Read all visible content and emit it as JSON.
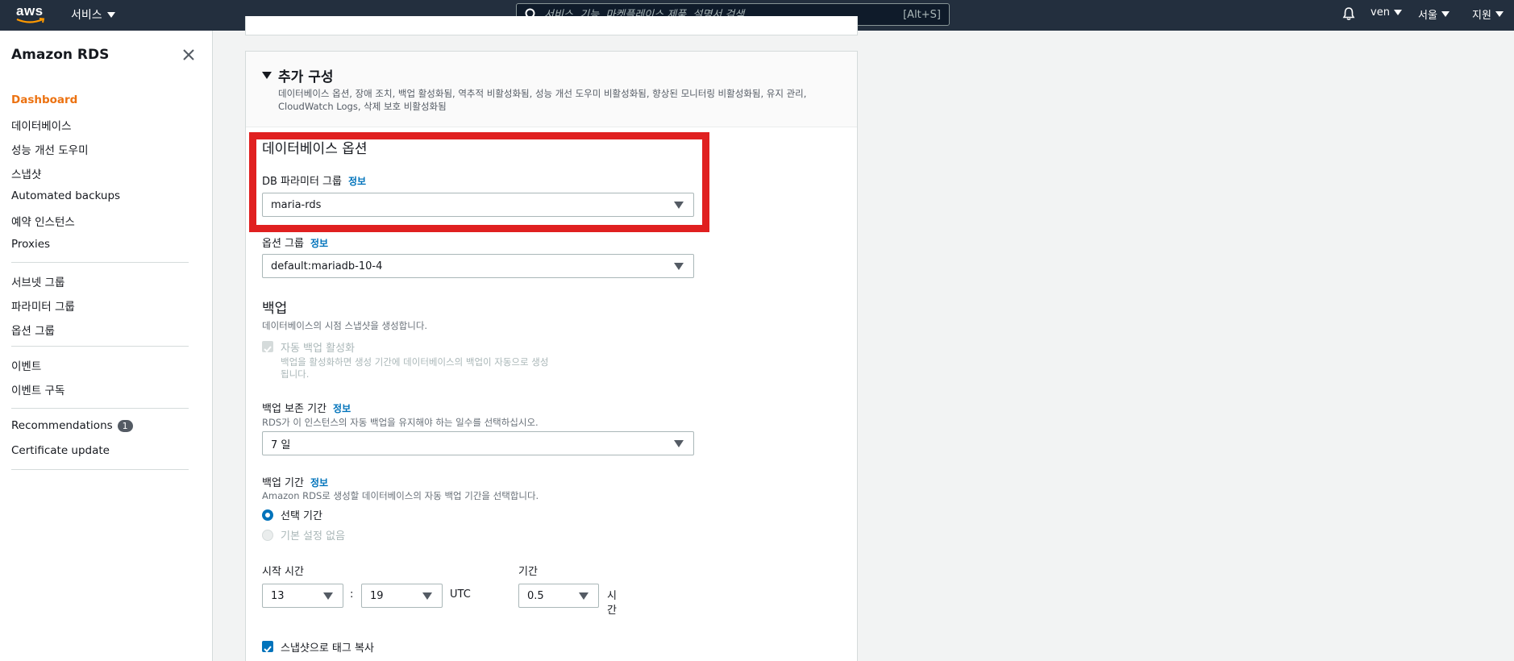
{
  "topnav": {
    "logo_text": "aws",
    "services_label": "서비스",
    "search_placeholder": "서비스, 기능, 마켓플레이스 제품, 설명서 검색",
    "search_shortcut": "[Alt+S]",
    "user_label": "ven",
    "region_label": "서울",
    "support_label": "지원"
  },
  "sidebar": {
    "title": "Amazon RDS",
    "items": [
      {
        "label": "Dashboard",
        "active": true
      },
      {
        "label": "데이터베이스"
      },
      {
        "label": "성능 개선 도우미"
      },
      {
        "label": "스냅샷"
      },
      {
        "label": "Automated backups"
      },
      {
        "label": "예약 인스턴스"
      },
      {
        "label": "Proxies"
      },
      {
        "label": "서브넷 그룹"
      },
      {
        "label": "파라미터 그룹"
      },
      {
        "label": "옵션 그룹"
      },
      {
        "label": "이벤트"
      },
      {
        "label": "이벤트 구독"
      },
      {
        "label": "Recommendations",
        "badge": "1"
      },
      {
        "label": "Certificate update"
      }
    ]
  },
  "additional_config": {
    "title": "추가 구성",
    "description": "데이터베이스 옵션, 장애 조치, 백업 활성화됨, 역추적 비활성화됨, 성능 개선 도우미 비활성화됨, 향상된 모니터링 비활성화됨, 유지 관리, CloudWatch Logs, 삭제 보호 비활성화됨"
  },
  "db_options": {
    "heading": "데이터베이스 옵션",
    "param_group_label": "DB 파라미터 그룹",
    "param_group_value": "maria-rds",
    "option_group_label": "옵션 그룹",
    "option_group_value": "default:mariadb-10-4"
  },
  "info_label": "정보",
  "backup": {
    "heading": "백업",
    "description": "데이터베이스의 시점 스냅샷을 생성합니다.",
    "auto_backup_label": "자동 백업 활성화",
    "auto_backup_help": "백업을 활성화하면 생성 기간에 데이터베이스의 백업이 자동으로 생성",
    "auto_backup_help2": "됩니다.",
    "retention_label": "백업 보존 기간",
    "retention_help": "RDS가 이 인스턴스의 자동 백업을 유지해야 하는 일수를 선택하십시오.",
    "retention_value": "7 일",
    "window_label": "백업 기간",
    "window_help": "Amazon RDS로 생성할 데이터베이스의 자동 백업 기간을 선택합니다.",
    "window_option_select": "선택 기간",
    "window_option_none": "기본 설정 없음",
    "start_time_label": "시작 시간",
    "start_hour": "13",
    "colon": ":",
    "start_minute": "19",
    "utc_label": "UTC",
    "duration_label": "기간",
    "duration_value": "0.5",
    "duration_unit_1": "시",
    "duration_unit_2": "간",
    "copy_tags_label": "스냅샷으로 태그 복사"
  }
}
